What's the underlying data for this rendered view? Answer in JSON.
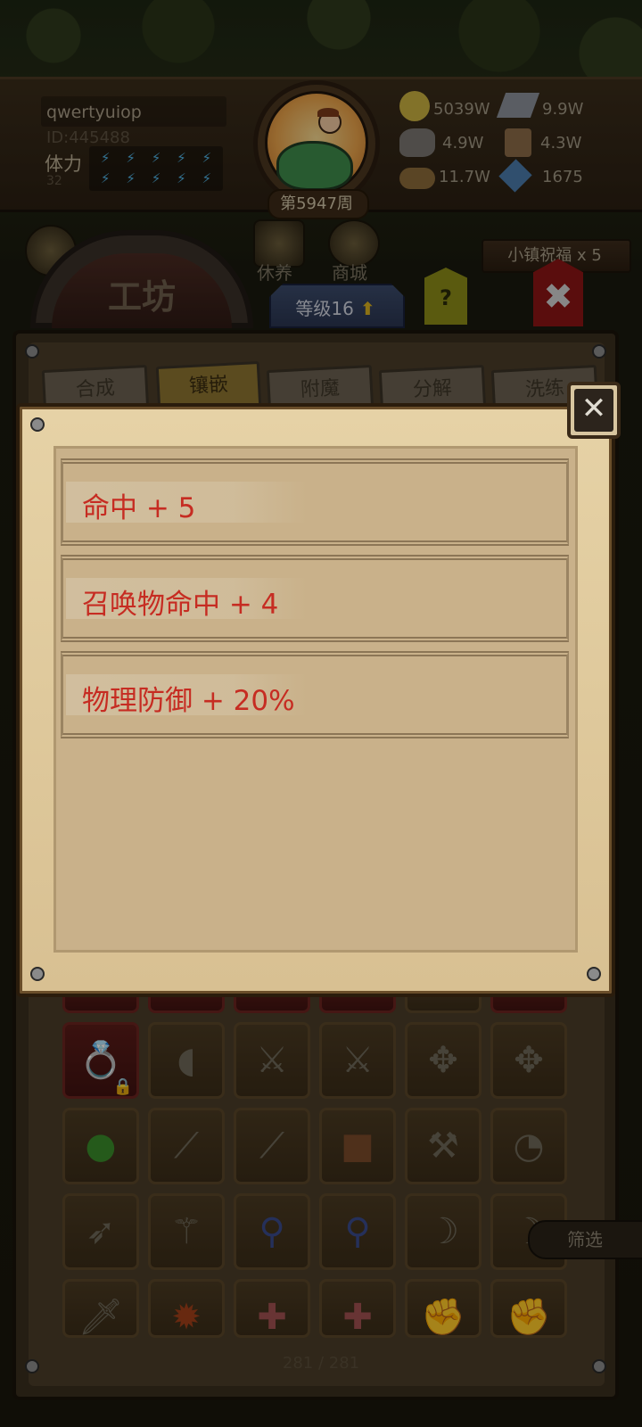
{
  "player": {
    "name": "qwertyuiop",
    "id": "ID:445488",
    "stamina_label": "体力",
    "stamina_value": "32",
    "week": "第5947周"
  },
  "resources": [
    {
      "icon": "gold-coin-icon",
      "value": "5039W"
    },
    {
      "icon": "silver-ingot-icon",
      "value": "9.9W"
    },
    {
      "icon": "stone-ore-icon",
      "value": "4.9W"
    },
    {
      "icon": "leather-icon",
      "value": "4.3W"
    },
    {
      "icon": "wood-log-icon",
      "value": "11.7W"
    },
    {
      "icon": "blue-crystal-icon",
      "value": "1675"
    }
  ],
  "nav": {
    "rest_label": "休养",
    "shop_label": "商城",
    "blessing": "小镇祝福 x 5"
  },
  "workshop": {
    "title": "工坊",
    "level": "等级16",
    "help": "?",
    "tabs": [
      "合成",
      "镶嵌",
      "附魔",
      "分解",
      "洗练"
    ],
    "active_tab": "镶嵌",
    "filter_label": "筛选",
    "item_count": "281 / 281"
  },
  "popup": {
    "stats": [
      "命中 + 5",
      "召唤物命中 + 4",
      "物理防御 + 20%"
    ]
  },
  "colors": {
    "stat_text": "#c62c22",
    "parchment": "#c9b18a"
  }
}
